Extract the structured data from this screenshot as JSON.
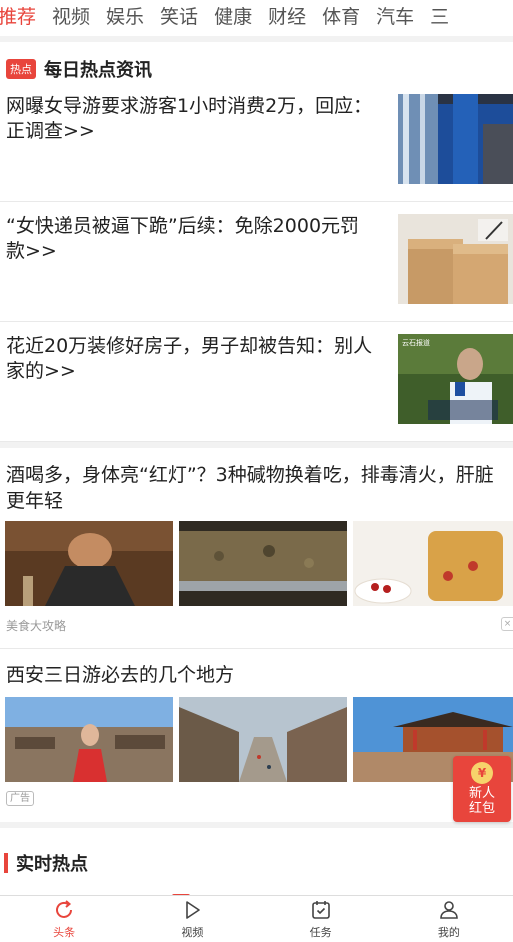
{
  "tabs": [
    "推荐",
    "视频",
    "娱乐",
    "笑话",
    "健康",
    "财经",
    "体育",
    "汽车",
    "三"
  ],
  "hot": {
    "badge": "热点",
    "title": "每日热点资讯",
    "items": [
      {
        "title": "网曝女导游要求游客1小时消费2万，回应：正调查>>",
        "thumb": "bus-interior-photo"
      },
      {
        "title": "“女快递员被逼下跪”后续：免除2000元罚款>>",
        "thumb": "parcel-signing-photo"
      },
      {
        "title": "花近20万装修好房子，男子却被告知：别人家的>>",
        "thumb": "interview-man-photo",
        "thumb_caption": "云石报道"
      }
    ]
  },
  "article1": {
    "title": "酒喝多，身体亮“红灯”？3种碱物换着吃，排毒清火，肝脏更年轻",
    "source": "美食大攻略",
    "images": [
      "drinking-man-photo",
      "dried-herbs-photo",
      "goji-tea-photo"
    ]
  },
  "article2": {
    "title": "西安三日游必去的几个地方",
    "ad_label": "广告",
    "images": [
      "ancient-village-woman-photo",
      "old-town-street-photo",
      "city-wall-tower-photo"
    ]
  },
  "red_envelope": {
    "coin": "¥",
    "line1": "新人",
    "line2": "红包"
  },
  "realtime": {
    "title": "实时热点"
  },
  "bottom_nav": [
    {
      "label": "头条",
      "icon": "refresh-icon",
      "active": true
    },
    {
      "label": "视频",
      "icon": "play-icon",
      "active": false
    },
    {
      "label": "任务",
      "icon": "calendar-check-icon",
      "active": false
    },
    {
      "label": "我的",
      "icon": "user-icon",
      "active": false
    }
  ],
  "colors": {
    "accent": "#e8453c"
  }
}
